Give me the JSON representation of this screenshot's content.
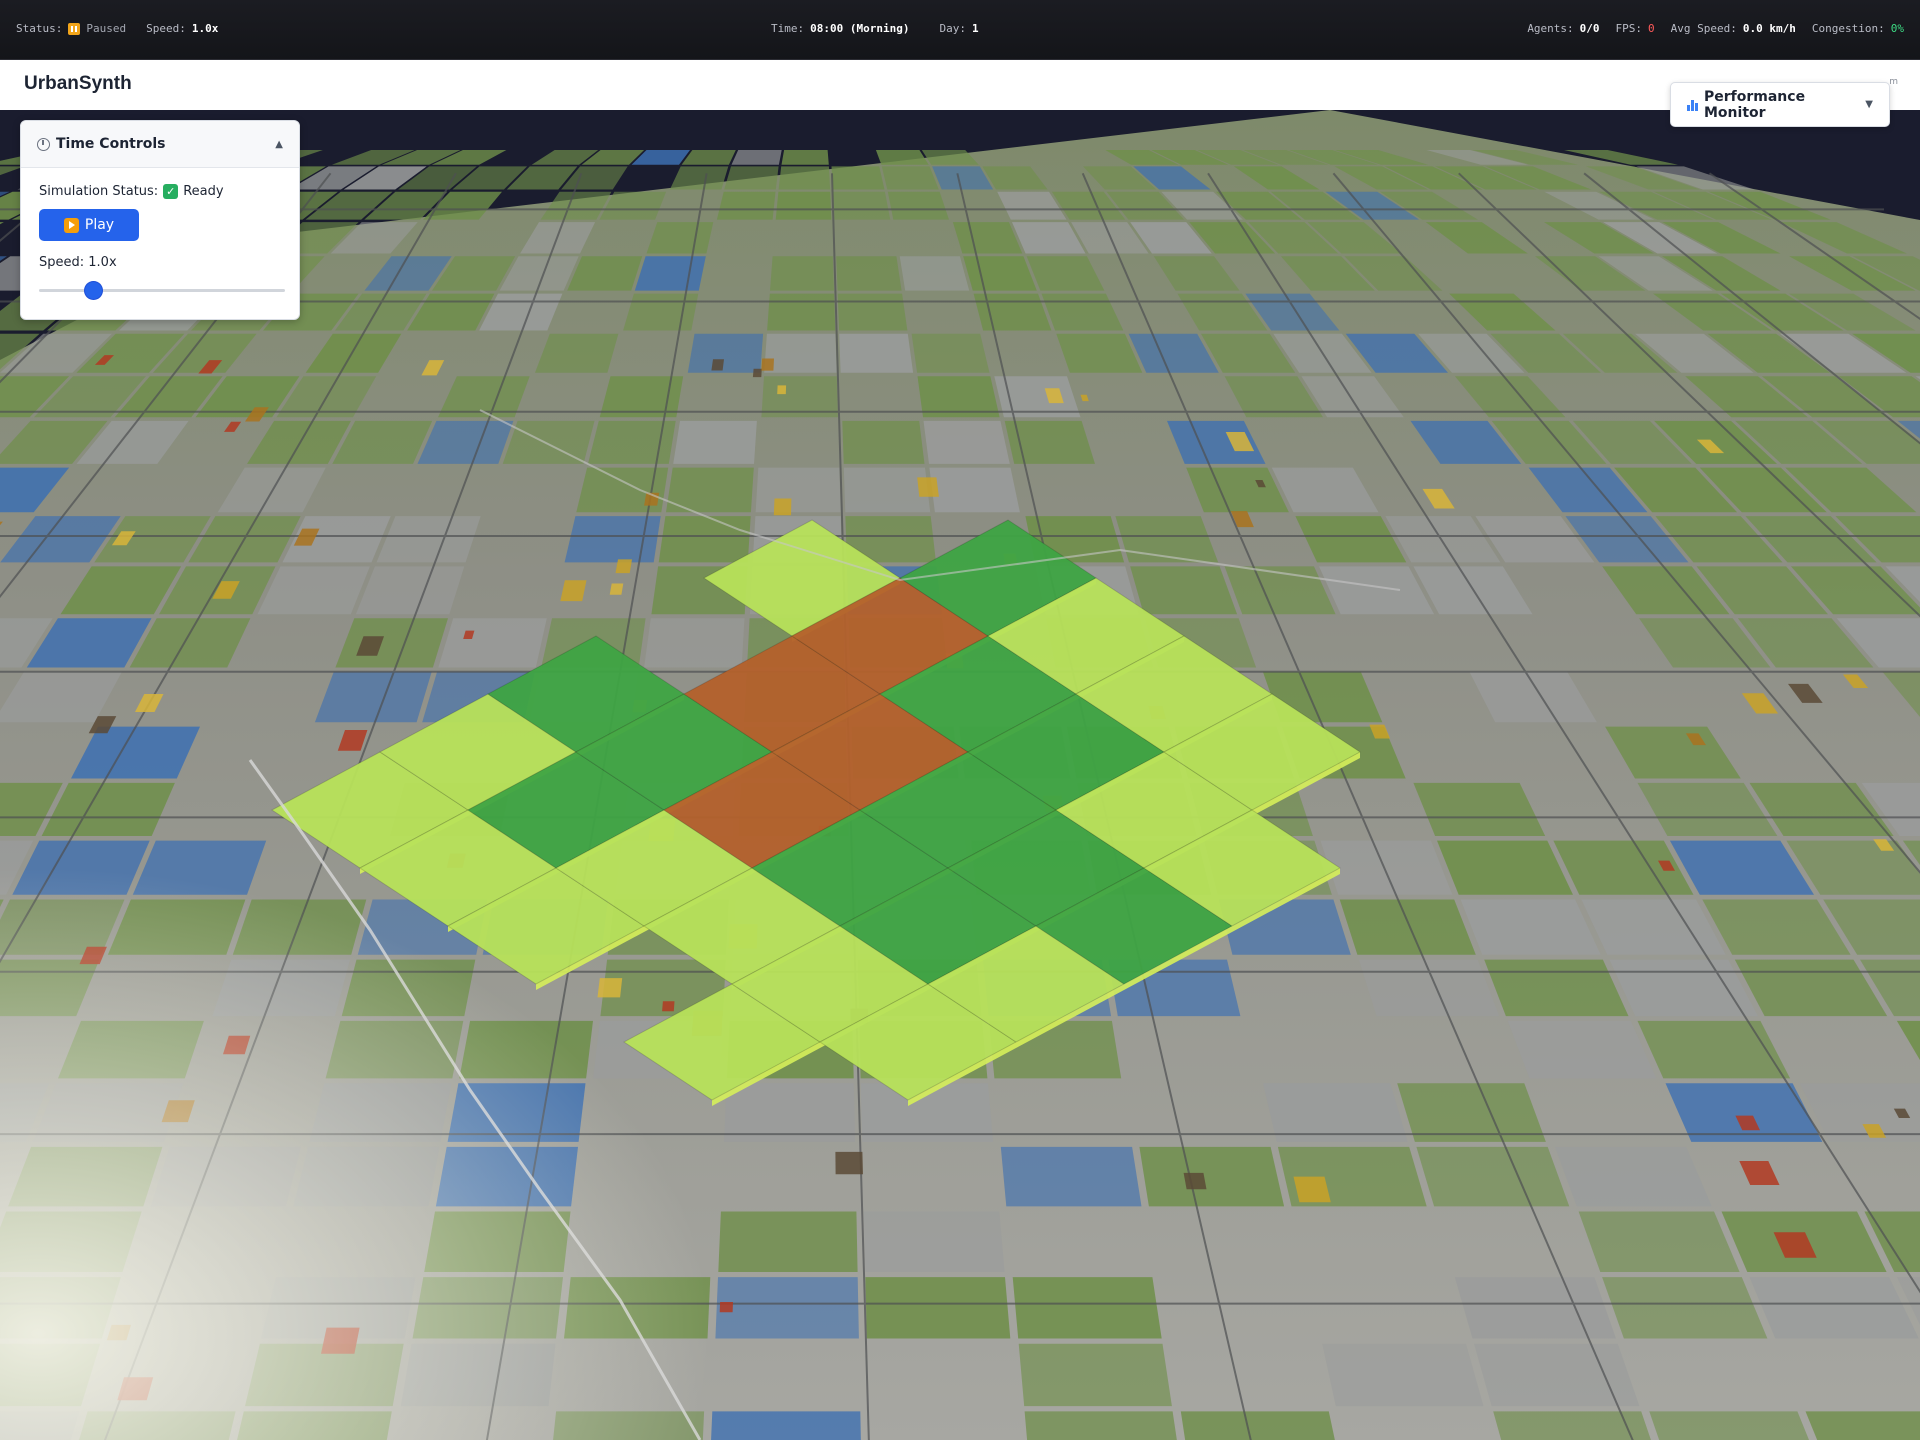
{
  "statusbar": {
    "status_label": "Status:",
    "status_value": "Paused",
    "speed_label": "Speed:",
    "speed_value": "1.0x",
    "time_label": "Time:",
    "time_value": "08:00 (Morning)",
    "day_label": "Day:",
    "day_value": "1",
    "agents_label": "Agents:",
    "agents_value": "0/0",
    "fps_label": "FPS:",
    "fps_value": "0",
    "avg_speed_label": "Avg Speed:",
    "avg_speed_value": "0.0 km/h",
    "congestion_label": "Congestion:",
    "congestion_value": "0%"
  },
  "header": {
    "title": "UrbanSynth",
    "hint": "m"
  },
  "time_controls": {
    "title": "Time Controls",
    "collapse_arrow": "▲",
    "status_label": "Simulation Status:",
    "status_value": "Ready",
    "play_label": "Play",
    "speed_label": "Speed:",
    "speed_value": "1.0x",
    "slider_fraction": 0.2
  },
  "performance_monitor": {
    "label": "Performance Monitor",
    "arrow": "▼"
  },
  "icons": {
    "status": "pause-icon",
    "panel": "stopwatch-icon",
    "ready": "check-icon",
    "play": "play-icon",
    "perf": "chart-icon"
  },
  "colors": {
    "accent": "#2563eb",
    "paused": "#f2a51a",
    "fps": "#ff5a5a",
    "congestion": "#3ddc84",
    "zone_lime": "#b8e25a",
    "zone_green": "#3fa544",
    "zone_brown": "#b4612c",
    "water": "#3c6fb2",
    "vegetation": "#6f8f4a",
    "road_block": "#9a9c9c"
  }
}
